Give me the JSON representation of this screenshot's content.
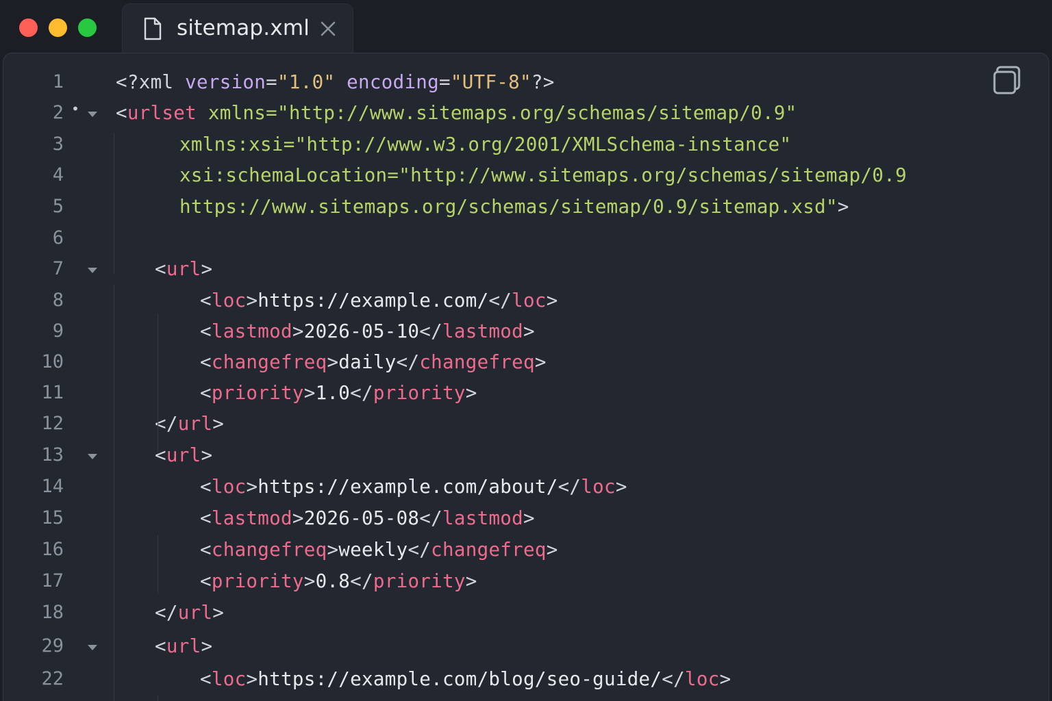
{
  "window": {
    "controls": [
      "close",
      "minimize",
      "zoom"
    ],
    "colors": {
      "close": "#fe5f57",
      "minimize": "#febc2e",
      "zoom": "#28c840"
    }
  },
  "tab": {
    "title": "sitemap.xml",
    "icon": "file-icon",
    "close_icon": "close-icon"
  },
  "toolbar": {
    "copy_icon": "copy-icon"
  },
  "theme": {
    "background": "#232830",
    "tag": "#ef6b8e",
    "attribute": "#c8a8f0",
    "string": "#e6c07b",
    "namespace": "#b7d36a",
    "text": "#e6e8ec",
    "line_number": "#8b929c"
  },
  "lines": [
    {
      "number": "1",
      "marker": "",
      "fold": false,
      "indent": 0,
      "tokens": [
        {
          "t": "<?xml ",
          "c": "punc"
        },
        {
          "t": "version",
          "c": "attr"
        },
        {
          "t": "=",
          "c": "punc"
        },
        {
          "t": "\"1.0\"",
          "c": "val"
        },
        {
          "t": " ",
          "c": "punc"
        },
        {
          "t": "encoding",
          "c": "attr"
        },
        {
          "t": "=",
          "c": "punc"
        },
        {
          "t": "\"UTF-8\"",
          "c": "val"
        },
        {
          "t": "?>",
          "c": "punc"
        }
      ]
    },
    {
      "number": "2",
      "marker": "•",
      "fold": true,
      "indent": 0,
      "tokens": [
        {
          "t": "<",
          "c": "punc"
        },
        {
          "t": "urlset",
          "c": "tag"
        },
        {
          "t": " xmlns=\"http://www.sitemaps.org/schemas/sitemap/0.9\"",
          "c": "ns"
        }
      ]
    },
    {
      "number": "3",
      "marker": "",
      "fold": false,
      "indent": 1,
      "tokens": [
        {
          "t": "xmlns:xsi=\"http://www.w3.org/2001/XMLSchema-instance\"",
          "c": "ns"
        }
      ]
    },
    {
      "number": "4",
      "marker": "",
      "fold": false,
      "indent": 1,
      "tokens": [
        {
          "t": "xsi:schemaLocation=\"http://www.sitemaps.org/schemas/sitemap/0.9",
          "c": "ns"
        }
      ]
    },
    {
      "number": "5",
      "marker": "",
      "fold": false,
      "indent": 1,
      "tokens": [
        {
          "t": "https://www.sitemaps.org/schemas/sitemap/0.9/sitemap.xsd\"",
          "c": "ns"
        },
        {
          "t": ">",
          "c": "punc"
        }
      ]
    },
    {
      "number": "6",
      "marker": "",
      "fold": false,
      "indent": 0,
      "tokens": []
    },
    {
      "number": "7",
      "marker": "",
      "fold": true,
      "indent": 2,
      "tokens": [
        {
          "t": "<",
          "c": "punc"
        },
        {
          "t": "url",
          "c": "tag"
        },
        {
          "t": ">",
          "c": "punc"
        }
      ]
    },
    {
      "number": "8",
      "marker": "",
      "fold": false,
      "indent": 3,
      "tokens": [
        {
          "t": "<",
          "c": "punc"
        },
        {
          "t": "loc",
          "c": "tag"
        },
        {
          "t": ">",
          "c": "punc"
        },
        {
          "t": "https://example.com/",
          "c": "text"
        },
        {
          "t": "</",
          "c": "punc"
        },
        {
          "t": "loc",
          "c": "tag"
        },
        {
          "t": ">",
          "c": "punc"
        }
      ]
    },
    {
      "number": "9",
      "marker": "",
      "fold": false,
      "indent": 3,
      "tokens": [
        {
          "t": "<",
          "c": "punc"
        },
        {
          "t": "lastmod",
          "c": "tag"
        },
        {
          "t": ">",
          "c": "punc"
        },
        {
          "t": "2026-05-10",
          "c": "text"
        },
        {
          "t": "</",
          "c": "punc"
        },
        {
          "t": "lastmod",
          "c": "tag"
        },
        {
          "t": ">",
          "c": "punc"
        }
      ]
    },
    {
      "number": "10",
      "marker": "",
      "fold": false,
      "indent": 3,
      "tokens": [
        {
          "t": "<",
          "c": "punc"
        },
        {
          "t": "changefreq",
          "c": "tag"
        },
        {
          "t": ">",
          "c": "punc"
        },
        {
          "t": "daily",
          "c": "text"
        },
        {
          "t": "</",
          "c": "punc"
        },
        {
          "t": "changefreq",
          "c": "tag"
        },
        {
          "t": ">",
          "c": "punc"
        }
      ]
    },
    {
      "number": "11",
      "marker": "",
      "fold": false,
      "indent": 3,
      "tokens": [
        {
          "t": "<",
          "c": "punc"
        },
        {
          "t": "priority",
          "c": "tag"
        },
        {
          "t": ">",
          "c": "punc"
        },
        {
          "t": "1.0",
          "c": "text"
        },
        {
          "t": "</",
          "c": "punc"
        },
        {
          "t": "priority",
          "c": "tag"
        },
        {
          "t": ">",
          "c": "punc"
        }
      ]
    },
    {
      "number": "12",
      "marker": "",
      "fold": false,
      "indent": 2,
      "tokens": [
        {
          "t": "</",
          "c": "punc"
        },
        {
          "t": "url",
          "c": "tag"
        },
        {
          "t": ">",
          "c": "punc"
        }
      ]
    },
    {
      "number": "13",
      "marker": "",
      "fold": true,
      "indent": 2,
      "tokens": [
        {
          "t": "<",
          "c": "punc"
        },
        {
          "t": "url",
          "c": "tag"
        },
        {
          "t": ">",
          "c": "punc"
        }
      ]
    },
    {
      "number": "14",
      "marker": "",
      "fold": false,
      "indent": 3,
      "tokens": [
        {
          "t": "<",
          "c": "punc"
        },
        {
          "t": "loc",
          "c": "tag"
        },
        {
          "t": ">",
          "c": "punc"
        },
        {
          "t": "https://example.com/about/",
          "c": "text"
        },
        {
          "t": "</",
          "c": "punc"
        },
        {
          "t": "loc",
          "c": "tag"
        },
        {
          "t": ">",
          "c": "punc"
        }
      ]
    },
    {
      "number": "15",
      "marker": "",
      "fold": false,
      "indent": 3,
      "tokens": [
        {
          "t": "<",
          "c": "punc"
        },
        {
          "t": "lastmod",
          "c": "tag"
        },
        {
          "t": ">",
          "c": "punc"
        },
        {
          "t": "2026-05-08",
          "c": "text"
        },
        {
          "t": "</",
          "c": "punc"
        },
        {
          "t": "lastmod",
          "c": "tag"
        },
        {
          "t": ">",
          "c": "punc"
        }
      ]
    },
    {
      "number": "16",
      "marker": "",
      "fold": false,
      "indent": 3,
      "tokens": [
        {
          "t": "<",
          "c": "punc"
        },
        {
          "t": "changefreq",
          "c": "tag"
        },
        {
          "t": ">",
          "c": "punc"
        },
        {
          "t": "weekly",
          "c": "text"
        },
        {
          "t": "</",
          "c": "punc"
        },
        {
          "t": "changefreq",
          "c": "tag"
        },
        {
          "t": ">",
          "c": "punc"
        }
      ]
    },
    {
      "number": "17",
      "marker": "",
      "fold": false,
      "indent": 3,
      "tokens": [
        {
          "t": "<",
          "c": "punc"
        },
        {
          "t": "priority",
          "c": "tag"
        },
        {
          "t": ">",
          "c": "punc"
        },
        {
          "t": "0.8",
          "c": "text"
        },
        {
          "t": "</",
          "c": "punc"
        },
        {
          "t": "priority",
          "c": "tag"
        },
        {
          "t": ">",
          "c": "punc"
        }
      ]
    },
    {
      "number": "18",
      "marker": "",
      "fold": false,
      "indent": 2,
      "tokens": [
        {
          "t": "</",
          "c": "punc"
        },
        {
          "t": "url",
          "c": "tag"
        },
        {
          "t": ">",
          "c": "punc"
        }
      ]
    },
    {
      "number": "29",
      "marker": "",
      "fold": true,
      "indent": 2,
      "tokens": [
        {
          "t": "<",
          "c": "punc"
        },
        {
          "t": "url",
          "c": "tag"
        },
        {
          "t": ">",
          "c": "punc"
        }
      ]
    },
    {
      "number": "22",
      "marker": "",
      "fold": false,
      "indent": 3,
      "tokens": [
        {
          "t": "<",
          "c": "punc"
        },
        {
          "t": "loc",
          "c": "tag"
        },
        {
          "t": ">",
          "c": "punc"
        },
        {
          "t": "https://example.com/blog/seo-guide/",
          "c": "text"
        },
        {
          "t": "</",
          "c": "punc"
        },
        {
          "t": "loc",
          "c": "tag"
        },
        {
          "t": ">",
          "c": "punc"
        }
      ]
    }
  ]
}
